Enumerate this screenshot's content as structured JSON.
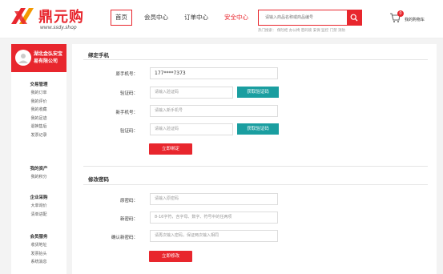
{
  "brand": {
    "name": "鼎元购",
    "url": "www.ssdy.shop",
    "color": "#e8262d"
  },
  "nav": {
    "home": "首页",
    "member": "会员中心",
    "orders": "订单中心",
    "security": "安全中心"
  },
  "search": {
    "placeholder": "请输入商品名称或商品编号",
    "hotwords": "热门搜索：  保险柜 办公椅 密码锁 安保 监控 门禁 消防"
  },
  "cart": {
    "count": "0",
    "label": "我的购物车"
  },
  "sidebar": {
    "company": "湖北金弘安宝易有限公司",
    "groups": [
      {
        "title": "交易管理",
        "items": [
          "我的订单",
          "我的评价",
          "我的收藏",
          "我的足迹",
          "退换售后",
          "发票记录"
        ]
      },
      {
        "title": "我的资产",
        "items": [
          "我的积分"
        ]
      },
      {
        "title": "企业采购",
        "items": [
          "大单询价",
          "清单进配"
        ]
      },
      {
        "title": "会员服务",
        "items": [
          "收货地址",
          "发票抬头",
          "系统消息"
        ]
      }
    ]
  },
  "bind_phone": {
    "title": "绑定手机",
    "old_phone_label": "原手机号：",
    "old_phone_value": "177****7373",
    "code_label": "验证码：",
    "code_placeholder": "请输入验证码",
    "get_code": "获取验证码",
    "new_phone_label": "新手机号：",
    "new_phone_placeholder": "请输入新手机号",
    "code2_label": "验证码：",
    "code2_placeholder": "请输入验证码",
    "get_code2": "获取验证码",
    "submit": "立即绑定"
  },
  "change_password": {
    "title": "修改密码",
    "old_label": "原密码：",
    "old_placeholder": "请输入原密码",
    "new_label": "新密码：",
    "new_placeholder": "8-16字符，含字母、数字、符号中的任两项",
    "confirm_label": "确认新密码：",
    "confirm_placeholder": "请再次输入密码，保证两次输入相同",
    "submit": "立即修改"
  },
  "colors": {
    "accent": "#e8262d",
    "teal": "#1a9ea0"
  }
}
